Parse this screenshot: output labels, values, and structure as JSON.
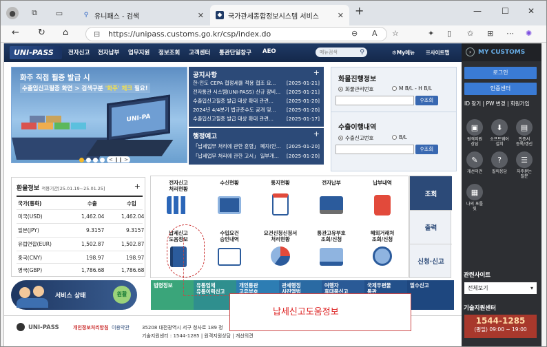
{
  "browser": {
    "tabs": [
      {
        "title": "유니패스 - 검색",
        "active": false
      },
      {
        "title": "국가관세종합정보시스템 서비스",
        "active": true
      }
    ],
    "url": "https://unipass.customs.go.kr/csp/index.do"
  },
  "site": {
    "logo": "UNI-PASS",
    "menu": [
      "전자신고",
      "전자납부",
      "업무지원",
      "정보조회",
      "고객센터",
      "통관단일창구",
      "AEO"
    ],
    "search_placeholder": "메뉴검색",
    "my_menu": "My메뉴",
    "sitemap": "사이트맵"
  },
  "banner": {
    "line1": "화주 직접 필증 발급 시",
    "line2_a": "수출입신고필증 화면 > 검색구분 ",
    "line2_hl": "'화주'",
    "line2_b": " 체크",
    "line2_c": " 필요!",
    "screen_text": "UNI-PA"
  },
  "notice": {
    "title": "공지사항",
    "items": [
      {
        "text": "한-인도 CEPA 협정세율 적용 협조 요...",
        "date": "[2025-01-21]"
      },
      {
        "text": "전자통관 시스템(UNI-PASS) 신규 장비...",
        "date": "[2025-01-21]"
      },
      {
        "text": "수출입신고필증 발급 대상 확대 관련...",
        "date": "[2025-01-20]"
      },
      {
        "text": "2024년 4/4분기 법규준수도 공개 및...",
        "date": "[2025-01-20]"
      },
      {
        "text": "수출입신고필증 발급 대상 확대 관련...",
        "date": "[2025-01-17]"
      }
    ]
  },
  "preview": {
    "title": "행정예고",
    "items": [
      {
        "text": "「납세업무 처리에 관한 훈령」 폐지(안...",
        "date": "[2025-01-20]"
      },
      {
        "text": "「납세업무 처리에 관한 고시」 일부개...",
        "date": "[2025-01-20]"
      }
    ]
  },
  "cargo": {
    "title": "화물진행정보",
    "radio1": "화물관리번호",
    "radio2": "M B/L - H B/L",
    "button": "조회"
  },
  "export": {
    "title": "수출이행내역",
    "radio1": "수출신고번호",
    "radio2": "B/L",
    "button": "조회"
  },
  "exchange": {
    "title": "환율정보",
    "period": "적용기간[25.01.19~25.01.25]",
    "headers": [
      "국가(통화)",
      "수출",
      "수입"
    ],
    "rows": [
      [
        "미국(USD)",
        "1,462.04",
        "1,462.04"
      ],
      [
        "일본(JPY)",
        "9.3157",
        "9.3157"
      ],
      [
        "유럽연합(EUR)",
        "1,502.87",
        "1,502.87"
      ],
      [
        "중국(CNY)",
        "198.97",
        "198.97"
      ],
      [
        "영국(GBP)",
        "1,786.68",
        "1,786.68"
      ]
    ]
  },
  "services": [
    "전자신고\n처리현황",
    "수신현황",
    "통지현황",
    "전자납부",
    "납부내역",
    "납세신고\n도움정보",
    "수입요건\n승인내역",
    "요건신청신청서\n처리현황",
    "통관고유부호\n조회/신청",
    "해외거래처\n조회/신청"
  ],
  "side_tabs": [
    "조회",
    "출력",
    "신청·신고"
  ],
  "service_status": {
    "label": "서비스 상태",
    "badge": "원활"
  },
  "strip": [
    {
      "text": "법령정보",
      "color": "#3aa57a"
    },
    {
      "text": "유통업체\n유통이력신고",
      "color": "#2f8f8e"
    },
    {
      "text": "개인통관\n고유부호",
      "color": "#2d7db3"
    },
    {
      "text": "관세행정\n사진앨범",
      "color": "#2a6aa3"
    },
    {
      "text": "여행자\n휴대품신고",
      "color": "#2a5a96"
    },
    {
      "text": "국제우편물\n통관",
      "color": "#23508a"
    },
    {
      "text": "밀수신고",
      "color": "#1e477f"
    }
  ],
  "footer": {
    "brand": "UNI-PASS",
    "privacy": "개인정보처리방침",
    "terms": "이용약관",
    "address": "35208 대전광역시 서구 청사로 189 정",
    "line2": "기술지원센터 : 1544-1285  |  원격지원상담  |  개선의견"
  },
  "callout": "납세신고도움정보",
  "right_panel": {
    "title": "MY CUSTOMS",
    "login": "로그인",
    "cert": "인증센터",
    "links": "ID 찾기 | PW 변경 | 회원가입",
    "quick": [
      "원격지원\n상담",
      "소프트웨어\n설치",
      "인증서\n등록/갱신",
      "개선의견",
      "질의응답",
      "자주묻는\n질문",
      "나의 포틀\n릿"
    ],
    "related_title": "관련사이트",
    "related_select": "전체보기",
    "support_title": "기술지원센터",
    "phone": "1544-1285",
    "hours": "(평일) 09:00 ~ 19:00"
  }
}
